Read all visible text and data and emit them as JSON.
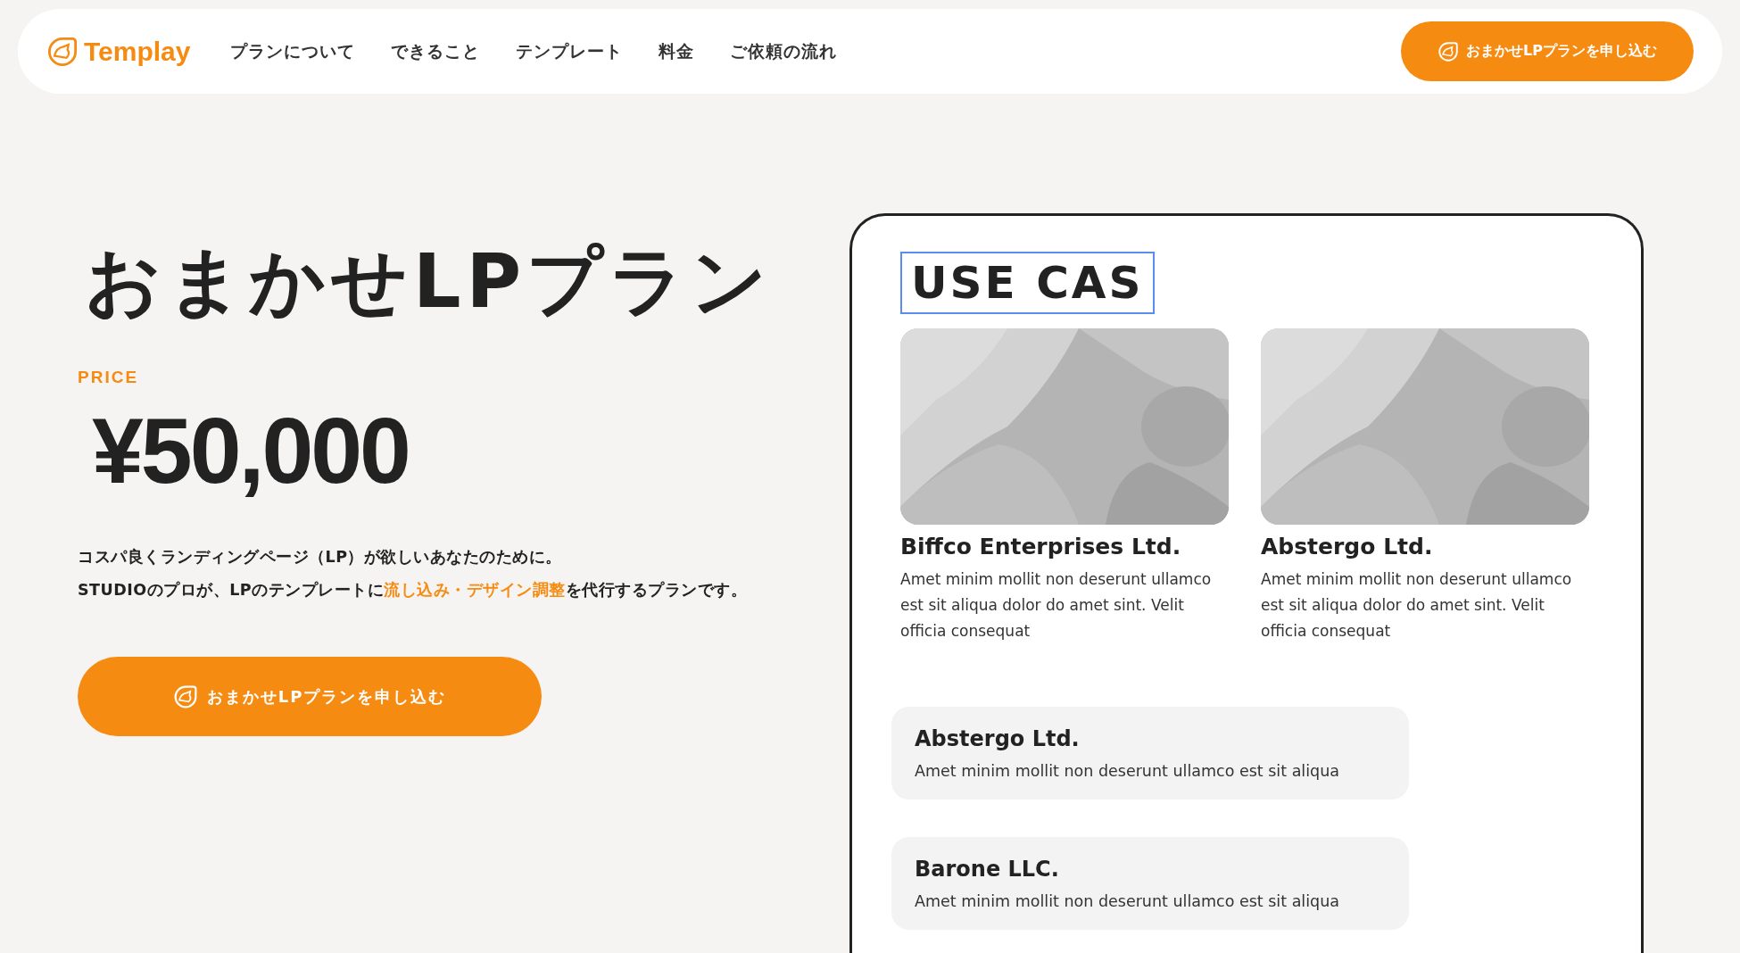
{
  "header": {
    "logo": "Templay",
    "nav": [
      {
        "label": "プランについて"
      },
      {
        "label": "できること"
      },
      {
        "label": "テンプレート"
      },
      {
        "label": "料金"
      },
      {
        "label": "ご依頼の流れ"
      }
    ],
    "cta": "おまかせLPプランを申し込む"
  },
  "hero": {
    "title": "おまかせLPプラン",
    "price_label": "PRICE",
    "price": "¥50,000",
    "description": [
      [
        {
          "text": "コスパ良くランディングページ（LP）が欲しいあなたのために。",
          "highlight": false
        }
      ],
      [
        {
          "text": "STUDIOのプロが、LPのテンプレートに",
          "highlight": false
        },
        {
          "text": "流し込み・デザイン調整",
          "highlight": true
        },
        {
          "text": "を代行するプランです。",
          "highlight": false
        }
      ]
    ],
    "cta": "おまかせLPプランを申し込む"
  },
  "preview": {
    "heading": "USE CAS",
    "heading_selected": true,
    "cases": [
      {
        "kind": "picture",
        "name": "Biffco Enterprises Ltd.",
        "text": "Amet minim mollit non deserunt ullamco est sit aliqua dolor do amet sint. Velit officia consequat"
      },
      {
        "kind": "picture",
        "name": "Abstergo Ltd.",
        "text": "Amet minim mollit non deserunt ullamco est sit aliqua dolor do amet sint. Velit officia consequat"
      }
    ],
    "list": [
      {
        "name": "Abstergo Ltd.",
        "text": "Amet minim mollit non deserunt ullamco est sit aliqua"
      },
      {
        "name": "Barone LLC.",
        "text": "Amet minim mollit non deserunt ullamco est sit aliqua"
      }
    ]
  }
}
